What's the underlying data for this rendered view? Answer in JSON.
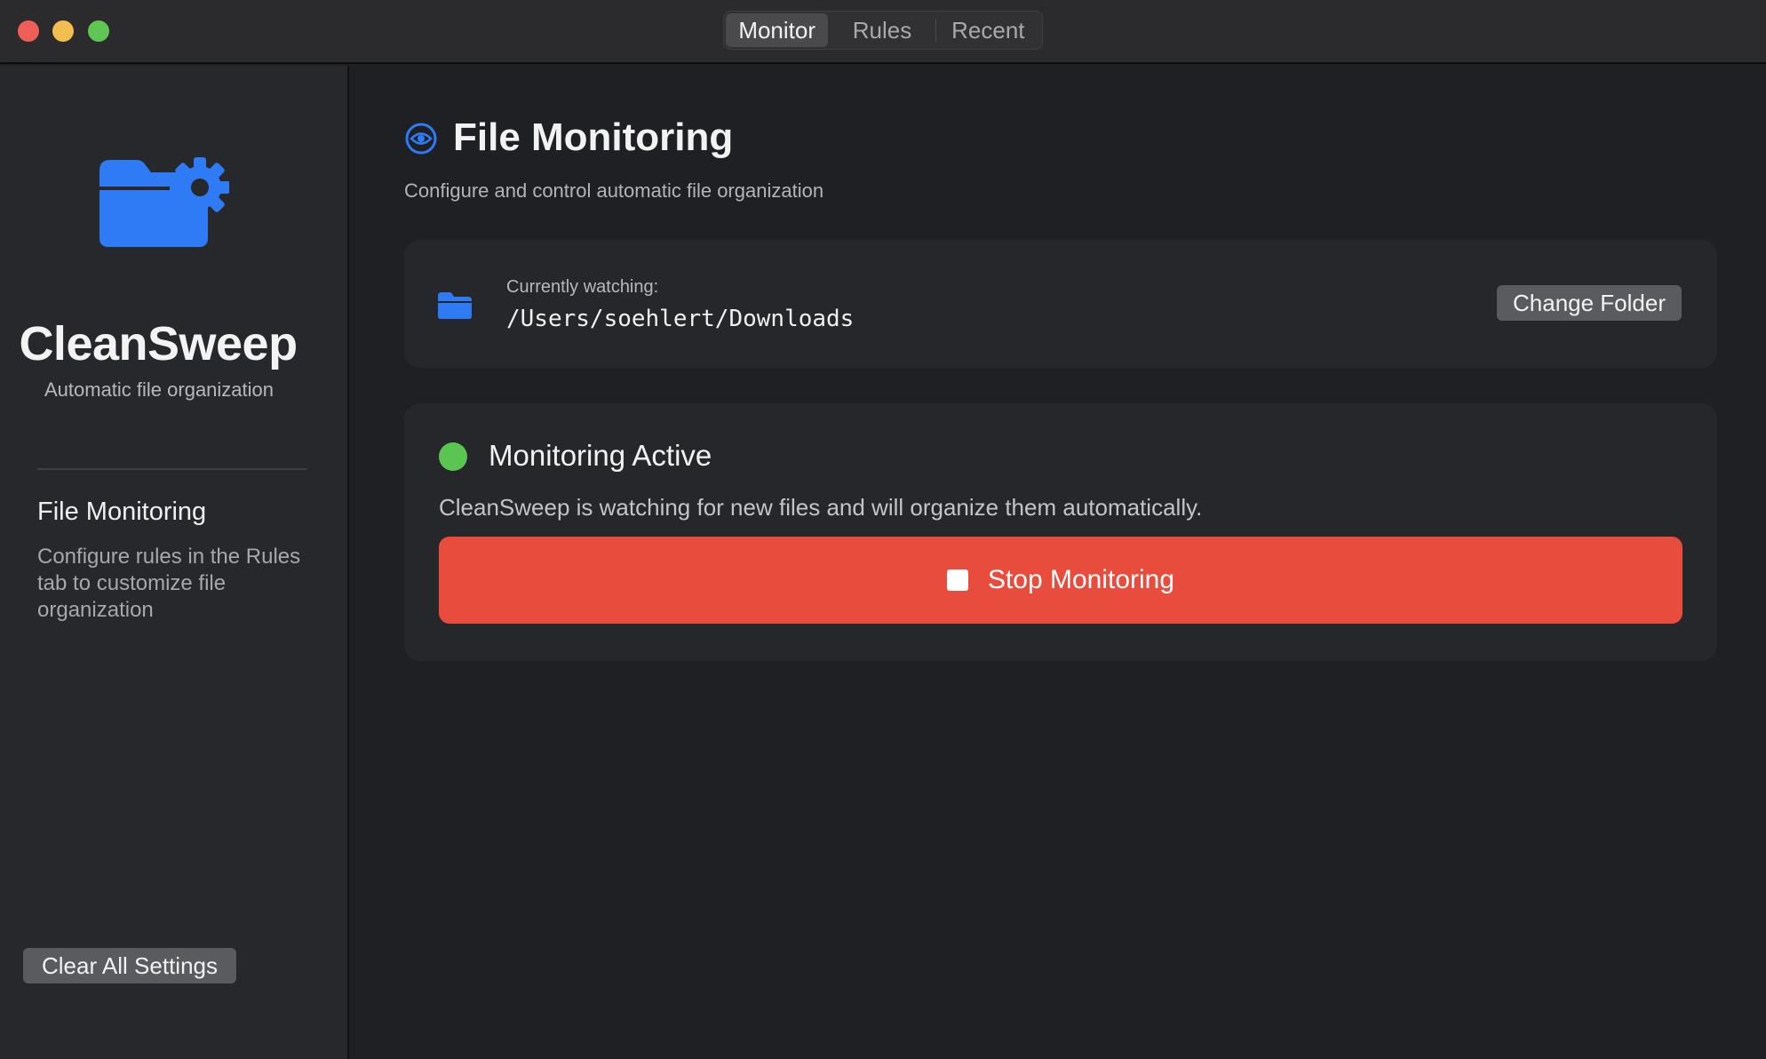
{
  "titlebar": {
    "tabs": [
      {
        "label": "Monitor",
        "active": true
      },
      {
        "label": "Rules",
        "active": false
      },
      {
        "label": "Recent",
        "active": false
      }
    ]
  },
  "sidebar": {
    "app_name": "CleanSweep",
    "tagline": "Automatic file organization",
    "section_heading": "File Monitoring",
    "section_description": "Configure rules in the Rules tab to customize file organization",
    "clear_button": "Clear All Settings",
    "logo_icon": "folder-gear-icon"
  },
  "main": {
    "title": "File Monitoring",
    "title_icon": "eye-icon",
    "subtitle": "Configure and control automatic file organization",
    "folder_card": {
      "label": "Currently watching:",
      "path": "/Users/soehlert/Downloads",
      "change_button": "Change Folder",
      "icon": "folder-icon"
    },
    "status_card": {
      "title": "Monitoring Active",
      "description": "CleanSweep is watching for new files and will organize them automatically.",
      "stop_button": "Stop Monitoring",
      "stop_icon": "stop-icon"
    }
  },
  "colors": {
    "accent": "#2f7bf5",
    "status_active": "#5bc551",
    "stop": "#e84c3d"
  }
}
